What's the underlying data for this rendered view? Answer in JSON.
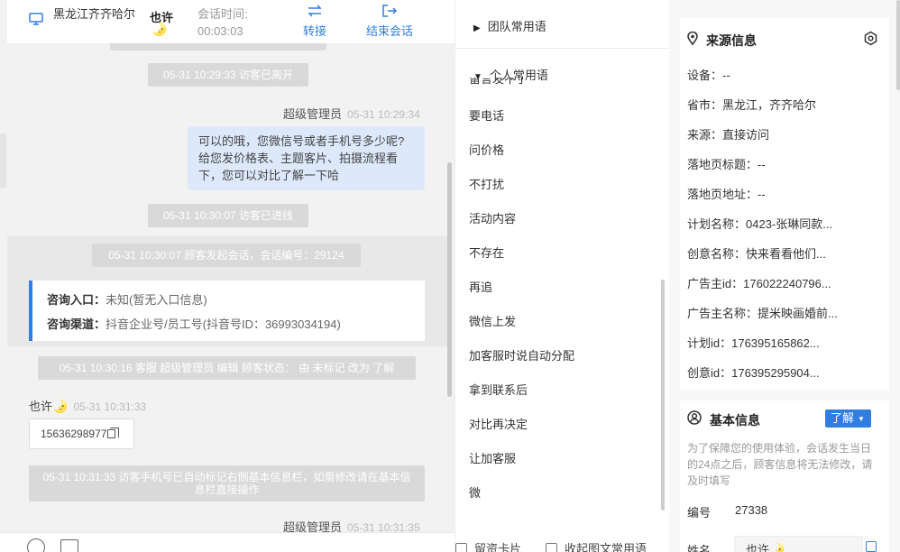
{
  "header": {
    "location": "黑龙江齐齐哈尔",
    "nickname": "也许",
    "moon": "🌛",
    "time_label": "会话时间:",
    "time_value": "00:03:03",
    "transfer_label": "转接",
    "end_label": "结束会话"
  },
  "chat": {
    "sys_left": "05-31 10:29:33 访客已离开",
    "agent_sender": "超级管理员",
    "agent_ts": "05-31 10:29:34",
    "agent_message": "可以的哦，您微信号或者手机号多少呢?给您发价格表、主题客片、拍摄流程看下，您可以对比了解一下哈",
    "sys_enter": "05-31 10:30:07 访客已进线",
    "sys_start": "05-31 10:30:07 顾客发起会话，会话编号：29124",
    "card": {
      "entry_label": "咨询入口：",
      "entry_value": "未知(暂无入口信息)",
      "channel_label": "咨询渠道：",
      "channel_value": "抖音企业号/员工号(抖音号ID：36993034194)"
    },
    "sys_status": "05-31 10:30:16 客服 超级管理员 编辑 顾客状态： 由 未标记 改为 了解",
    "visitor_ts": "05-31 10:31:33",
    "phone": "15636298977",
    "sys_phone": "05-31 10:31:33 访客手机号已自动标记右侧基本信息栏，如需修改请在基本信息栏直接操作",
    "agent_ts2": "05-31 10:31:35"
  },
  "phrases": {
    "team_group": "团队常用语",
    "personal_group": "个人常用语",
    "cut_item": "留言发不了",
    "items": [
      "要电话",
      "问价格",
      "不打扰",
      "活动内容",
      "不存在",
      "再追",
      "微信上发",
      "加客服时说自动分配",
      "拿到联系后",
      "对比再决定",
      "让加客服",
      "微"
    ],
    "footer_card": "留资卡片",
    "footer_collapse": "收起图文常用语"
  },
  "source": {
    "title": "来源信息",
    "rows": [
      "设备：--",
      "省市：黑龙江，齐齐哈尔",
      "来源：直接访问",
      "落地页标题：--",
      "落地页地址：--",
      "计划名称：0423-张琳同款...",
      "创意名称：快来看看他们...",
      "广告主id：176022240796...",
      "广告主名称：提米映画婚前...",
      "计划id：176395165862...",
      "创意id：176395295904..."
    ]
  },
  "basic": {
    "title": "基本信息",
    "tag": "了解",
    "note": "为了保障您的使用体验，会话发生当日的24点之后，顾客信息将无法修改，请及时填写",
    "num_label": "编号",
    "num_value": "27338",
    "name_label": "姓名",
    "name_value": "也许"
  }
}
